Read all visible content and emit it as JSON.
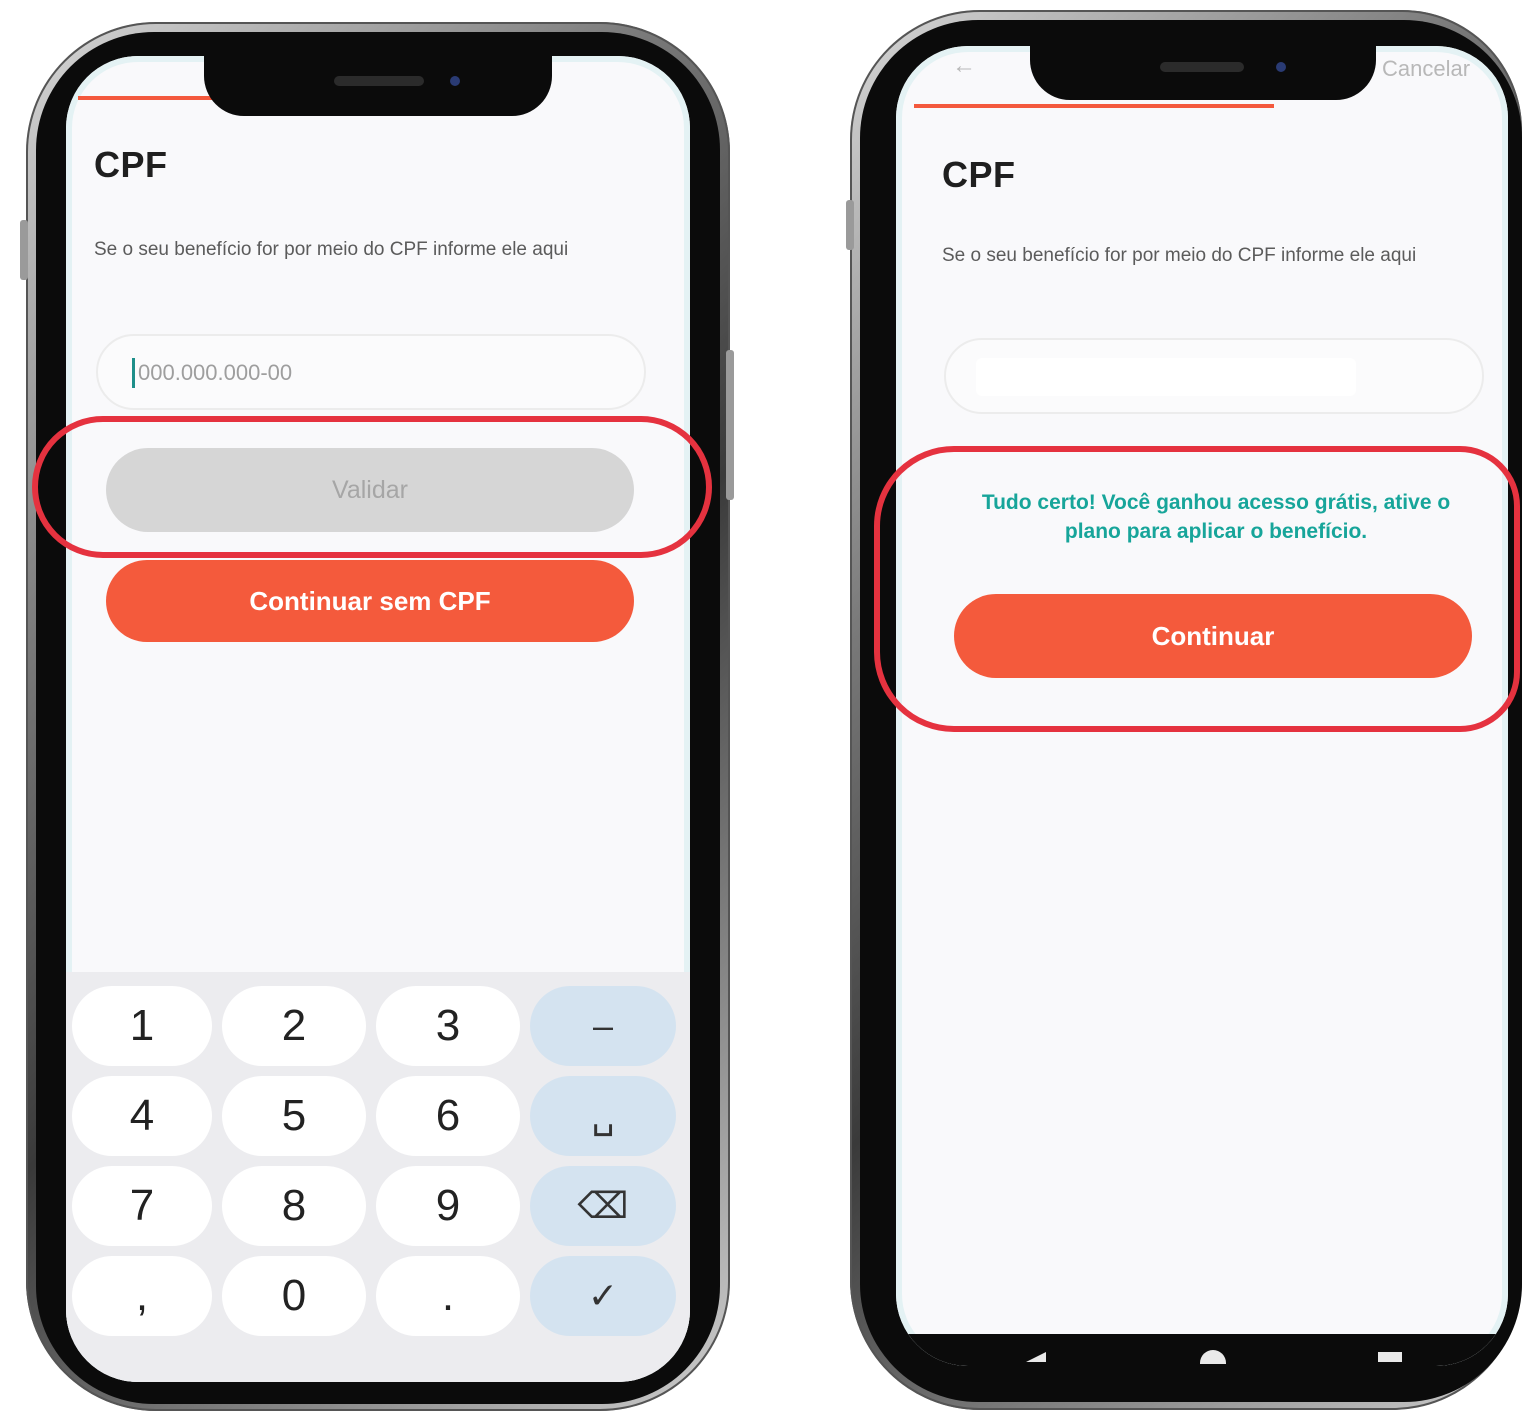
{
  "left_screen": {
    "title": "CPF",
    "description": "Se o seu benefício for por meio do CPF informe ele aqui",
    "input_placeholder": "000.000.000-00",
    "validate_label": "Validar",
    "continue_without_label": "Continuar sem CPF",
    "keypad": {
      "rows": [
        [
          "1",
          "2",
          "3",
          "–"
        ],
        [
          "4",
          "5",
          "6",
          "␣"
        ],
        [
          "7",
          "8",
          "9",
          "⌫"
        ],
        [
          ",",
          "0",
          ".",
          "✓"
        ]
      ]
    }
  },
  "right_screen": {
    "title": "CPF",
    "cancel_label": "Cancelar",
    "back_icon": "←",
    "description": "Se o seu benefício for por meio do CPF informe ele aqui",
    "success_message": "Tudo certo! Você ganhou acesso grátis, ative o plano para aplicar o benefício.",
    "continue_label": "Continuar"
  },
  "colors": {
    "accent": "#f45a3c",
    "success": "#17a59a",
    "highlight": "#e5323f",
    "disabled": "#d6d6d6"
  }
}
